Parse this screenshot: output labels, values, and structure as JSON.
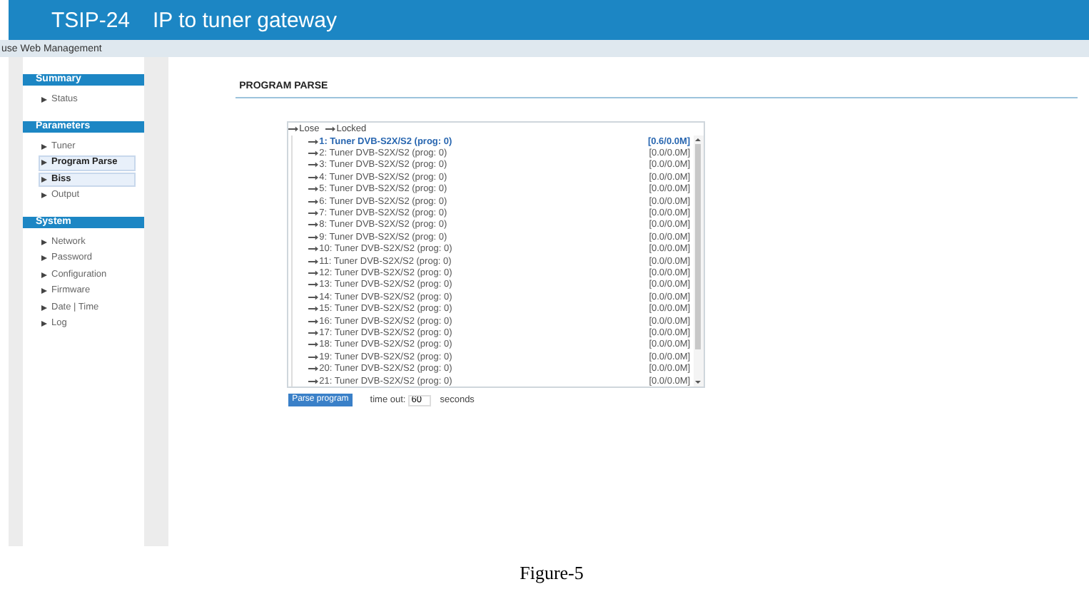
{
  "header": {
    "model": "TSIP-24",
    "title": "IP to tuner gateway"
  },
  "subbar": {
    "text": "use Web Management"
  },
  "sidebar": {
    "sections": [
      {
        "title": "Summary",
        "items": [
          {
            "label": "Status",
            "selected": false
          }
        ]
      },
      {
        "title": "Parameters",
        "items": [
          {
            "label": "Tuner",
            "selected": false
          },
          {
            "label": "Program Parse",
            "selected": true
          },
          {
            "label": "Biss",
            "selected": true
          },
          {
            "label": "Output",
            "selected": false
          }
        ]
      },
      {
        "title": "System",
        "items": [
          {
            "label": "Network",
            "selected": false
          },
          {
            "label": "Password",
            "selected": false
          },
          {
            "label": "Configuration",
            "selected": false
          },
          {
            "label": "Firmware",
            "selected": false
          },
          {
            "label": "Date | Time",
            "selected": false
          },
          {
            "label": "Log",
            "selected": false
          }
        ]
      }
    ]
  },
  "page_title": "PROGRAM PARSE",
  "legend": [
    "Lose",
    "Locked"
  ],
  "programs": [
    {
      "label": "1: Tuner DVB-S2X/S2 (prog: 0)",
      "rate": "[0.6/0.0M]",
      "selected": true
    },
    {
      "label": "2: Tuner DVB-S2X/S2 (prog: 0)",
      "rate": "[0.0/0.0M]",
      "selected": false
    },
    {
      "label": "3: Tuner DVB-S2X/S2 (prog: 0)",
      "rate": "[0.0/0.0M]",
      "selected": false
    },
    {
      "label": "4: Tuner DVB-S2X/S2 (prog: 0)",
      "rate": "[0.0/0.0M]",
      "selected": false
    },
    {
      "label": "5: Tuner DVB-S2X/S2 (prog: 0)",
      "rate": "[0.0/0.0M]",
      "selected": false
    },
    {
      "label": "6: Tuner DVB-S2X/S2 (prog: 0)",
      "rate": "[0.0/0.0M]",
      "selected": false
    },
    {
      "label": "7: Tuner DVB-S2X/S2 (prog: 0)",
      "rate": "[0.0/0.0M]",
      "selected": false
    },
    {
      "label": "8: Tuner DVB-S2X/S2 (prog: 0)",
      "rate": "[0.0/0.0M]",
      "selected": false
    },
    {
      "label": "9: Tuner DVB-S2X/S2 (prog: 0)",
      "rate": "[0.0/0.0M]",
      "selected": false
    },
    {
      "label": "10: Tuner DVB-S2X/S2 (prog: 0)",
      "rate": "[0.0/0.0M]",
      "selected": false
    },
    {
      "label": "11: Tuner DVB-S2X/S2 (prog: 0)",
      "rate": "[0.0/0.0M]",
      "selected": false
    },
    {
      "label": "12: Tuner DVB-S2X/S2 (prog: 0)",
      "rate": "[0.0/0.0M]",
      "selected": false
    },
    {
      "label": "13: Tuner DVB-S2X/S2 (prog: 0)",
      "rate": "[0.0/0.0M]",
      "selected": false
    },
    {
      "label": "14: Tuner DVB-S2X/S2 (prog: 0)",
      "rate": "[0.0/0.0M]",
      "selected": false
    },
    {
      "label": "15: Tuner DVB-S2X/S2 (prog: 0)",
      "rate": "[0.0/0.0M]",
      "selected": false
    },
    {
      "label": "16: Tuner DVB-S2X/S2 (prog: 0)",
      "rate": "[0.0/0.0M]",
      "selected": false
    },
    {
      "label": "17: Tuner DVB-S2X/S2 (prog: 0)",
      "rate": "[0.0/0.0M]",
      "selected": false
    },
    {
      "label": "18: Tuner DVB-S2X/S2 (prog: 0)",
      "rate": "[0.0/0.0M]",
      "selected": false
    },
    {
      "label": "19: Tuner DVB-S2X/S2 (prog: 0)",
      "rate": "[0.0/0.0M]",
      "selected": false
    },
    {
      "label": "20: Tuner DVB-S2X/S2 (prog: 0)",
      "rate": "[0.0/0.0M]",
      "selected": false
    },
    {
      "label": "21: Tuner DVB-S2X/S2 (prog: 0)",
      "rate": "[0.0/0.0M]",
      "selected": false
    }
  ],
  "parse_button": "Parse program",
  "timeout": {
    "label": "time out:",
    "value": "60",
    "unit": "seconds"
  },
  "caption": "Figure-5"
}
